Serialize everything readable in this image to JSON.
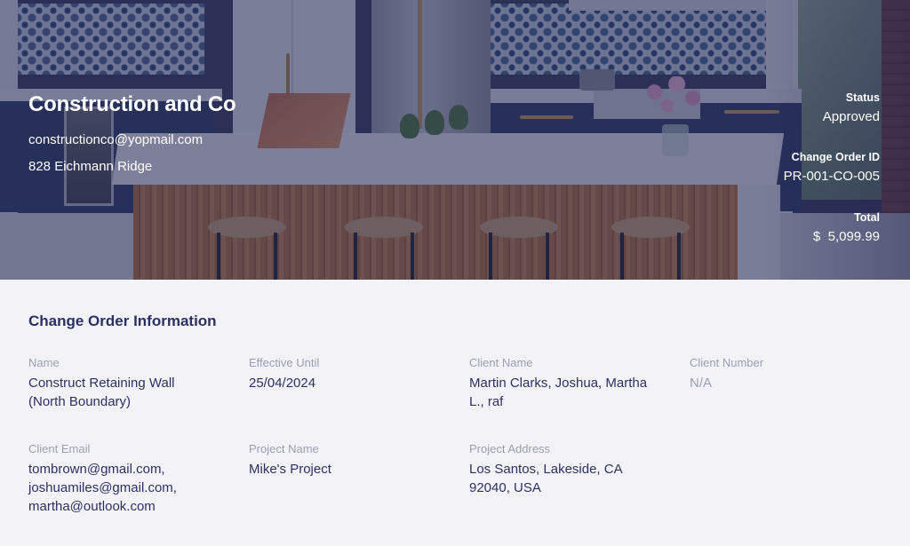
{
  "company": {
    "name": "Construction and Co",
    "email": "constructionco@yopmail.com",
    "address": "828 Eichmann Ridge"
  },
  "meta": {
    "status_label": "Status",
    "status_value": "Approved",
    "change_order_id_label": "Change Order ID",
    "change_order_id_value": "PR-001-CO-005",
    "total_label": "Total",
    "total_value": "$  5,099.99"
  },
  "info": {
    "title": "Change Order Information",
    "fields": [
      {
        "label": "Name",
        "value": "Construct Retaining Wall (North Boundary)"
      },
      {
        "label": "Effective Until",
        "value": "25/04/2024"
      },
      {
        "label": "Client Name",
        "value": "Martin Clarks, Joshua, Martha L., raf"
      },
      {
        "label": "Client Number",
        "value": "N/A"
      },
      {
        "label": "Client Email",
        "value": "tombrown@gmail.com, joshuamiles@gmail.com, martha@outlook.com"
      },
      {
        "label": "Project Name",
        "value": "Mike's Project"
      },
      {
        "label": "Project Address",
        "value": "Los Santos, Lakeside, CA 92040, USA"
      }
    ]
  },
  "colors": {
    "overlay": "#202452",
    "title_text": "#2b3064",
    "label_text": "#9a9eb5",
    "page_bg": "#f3f3f7"
  }
}
